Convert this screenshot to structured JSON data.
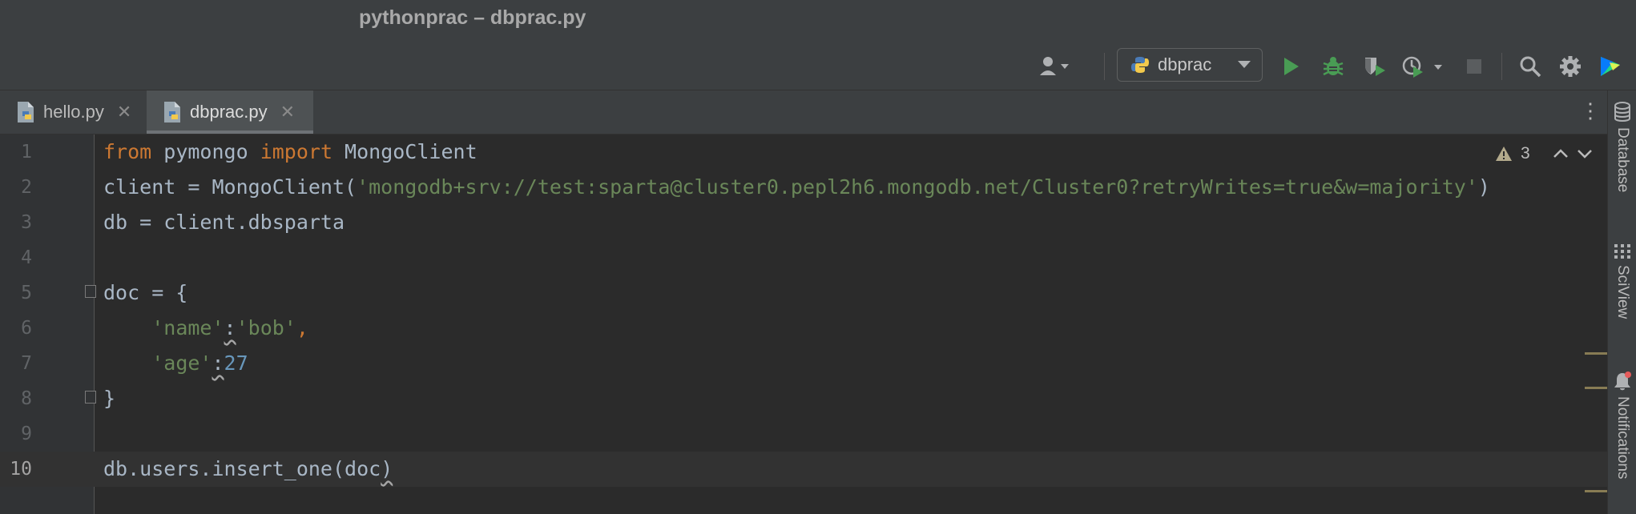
{
  "window": {
    "title": "pythonprac – dbprac.py"
  },
  "toolbar": {
    "run_config": "dbprac",
    "icons": [
      "user-icon",
      "python-icon",
      "run-icon",
      "debug-icon",
      "coverage-icon",
      "profile-icon",
      "stop-icon",
      "search-icon",
      "gear-icon",
      "plugin-icon"
    ]
  },
  "tabs": [
    {
      "label": "hello.py",
      "active": false
    },
    {
      "label": "dbprac.py",
      "active": true
    }
  ],
  "right_strip": {
    "database": "Database",
    "sciview": "SciView",
    "notifications": "Notifications"
  },
  "inspections": {
    "warning_count": "3"
  },
  "editor": {
    "current_line": 10,
    "lines": [
      {
        "number": "1",
        "text": "from pymongo import MongoClient"
      },
      {
        "number": "2",
        "text": "client = MongoClient('mongodb+srv://test:sparta@cluster0.pepl2h6.mongodb.net/Cluster0?retryWrites=true&w=majority')"
      },
      {
        "number": "3",
        "text": "db = client.dbsparta"
      },
      {
        "number": "4",
        "text": ""
      },
      {
        "number": "5",
        "text": "doc = {"
      },
      {
        "number": "6",
        "text": "    'name':'bob',"
      },
      {
        "number": "7",
        "text": "    'age':27"
      },
      {
        "number": "8",
        "text": "}"
      },
      {
        "number": "9",
        "text": ""
      },
      {
        "number": "10",
        "text": "db.users.insert_one(doc)"
      }
    ]
  },
  "colors": {
    "keyword": "#cc7832",
    "string": "#6a8759",
    "number": "#6897bb",
    "text": "#a9b7c6",
    "run": "#499c54"
  }
}
